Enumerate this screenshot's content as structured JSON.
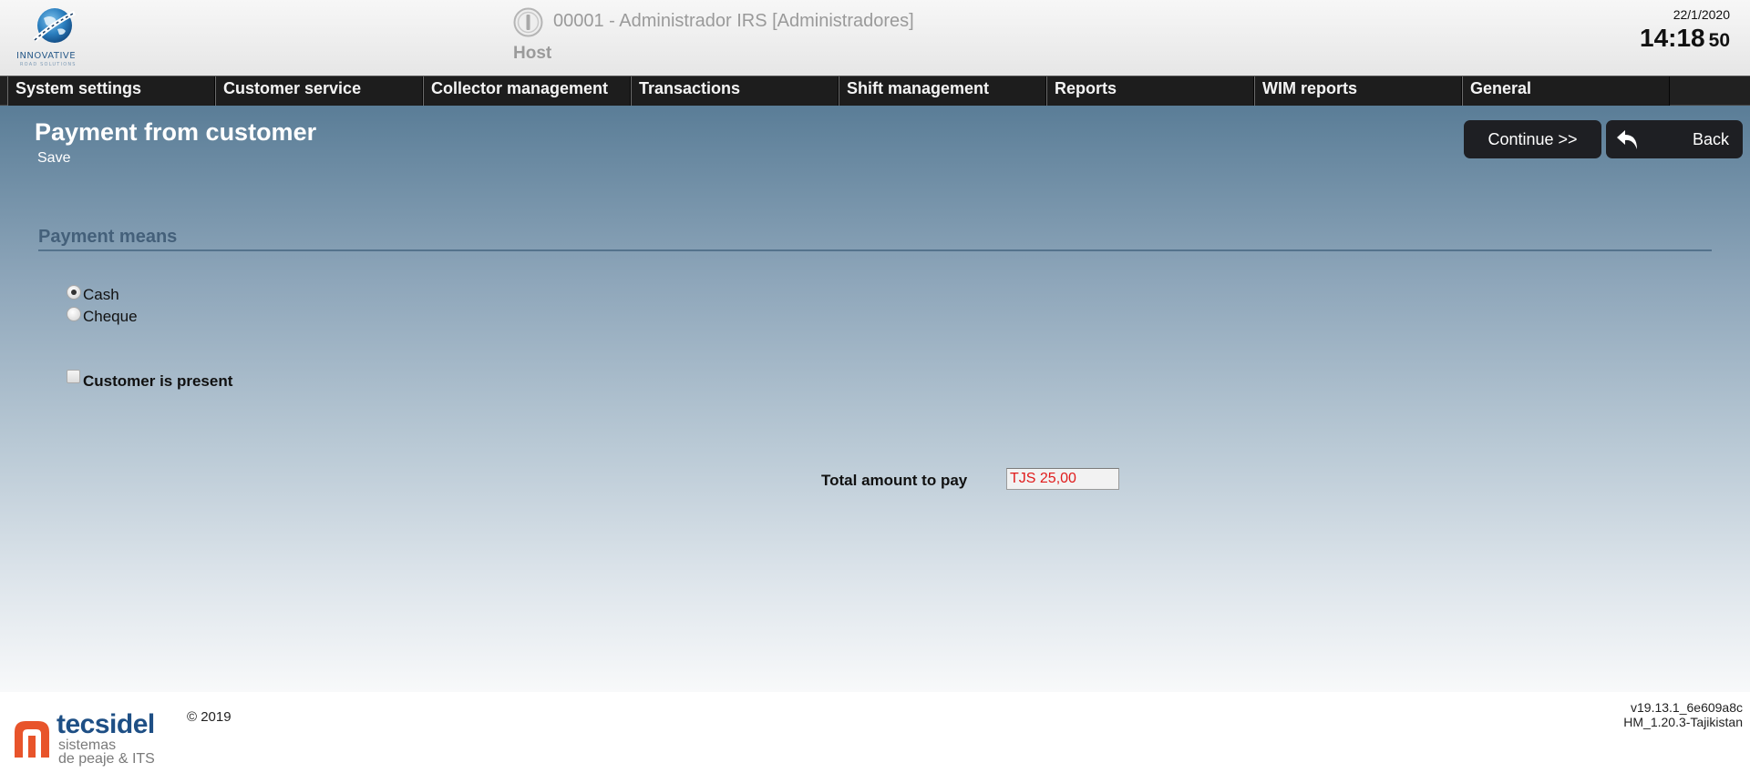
{
  "header": {
    "logo_text": "INNOVATIVE",
    "logo_subtext": "ROAD SOLUTIONS",
    "user": "00001 - Administrador IRS [Administradores]",
    "host": "Host",
    "date": "22/1/2020",
    "time": "14:18",
    "seconds": "50"
  },
  "menu": {
    "items": [
      {
        "label": "System settings"
      },
      {
        "label": "Customer service"
      },
      {
        "label": "Collector management"
      },
      {
        "label": "Transactions"
      },
      {
        "label": "Shift management"
      },
      {
        "label": "Reports"
      },
      {
        "label": "WIM reports"
      },
      {
        "label": "General"
      }
    ]
  },
  "page": {
    "title": "Payment from customer",
    "save_label": "Save",
    "continue_label": "Continue >>",
    "back_label": "Back"
  },
  "payment_means": {
    "title": "Payment means",
    "options": [
      {
        "label": "Cash",
        "checked": true
      },
      {
        "label": "Cheque",
        "checked": false
      }
    ],
    "customer_present_label": "Customer is present",
    "customer_present_checked": false
  },
  "total": {
    "label": "Total amount to pay",
    "value": "TJS 25,00",
    "value_color": "#e01b1b"
  },
  "footer": {
    "brand": "tecsidel",
    "brand_line1": "sistemas",
    "brand_line2": "de peaje & ITS",
    "brand_color": "#1e4f85",
    "brand_mark_color": "#e8542b",
    "copyright": "© 2019",
    "version_line1": "v19.13.1_6e609a8c",
    "version_line2": "HM_1.20.3-Tajikistan"
  },
  "icons": {
    "logo": "globe-road-logo-icon",
    "power": "power-icon",
    "back": "back-arrow-icon"
  }
}
